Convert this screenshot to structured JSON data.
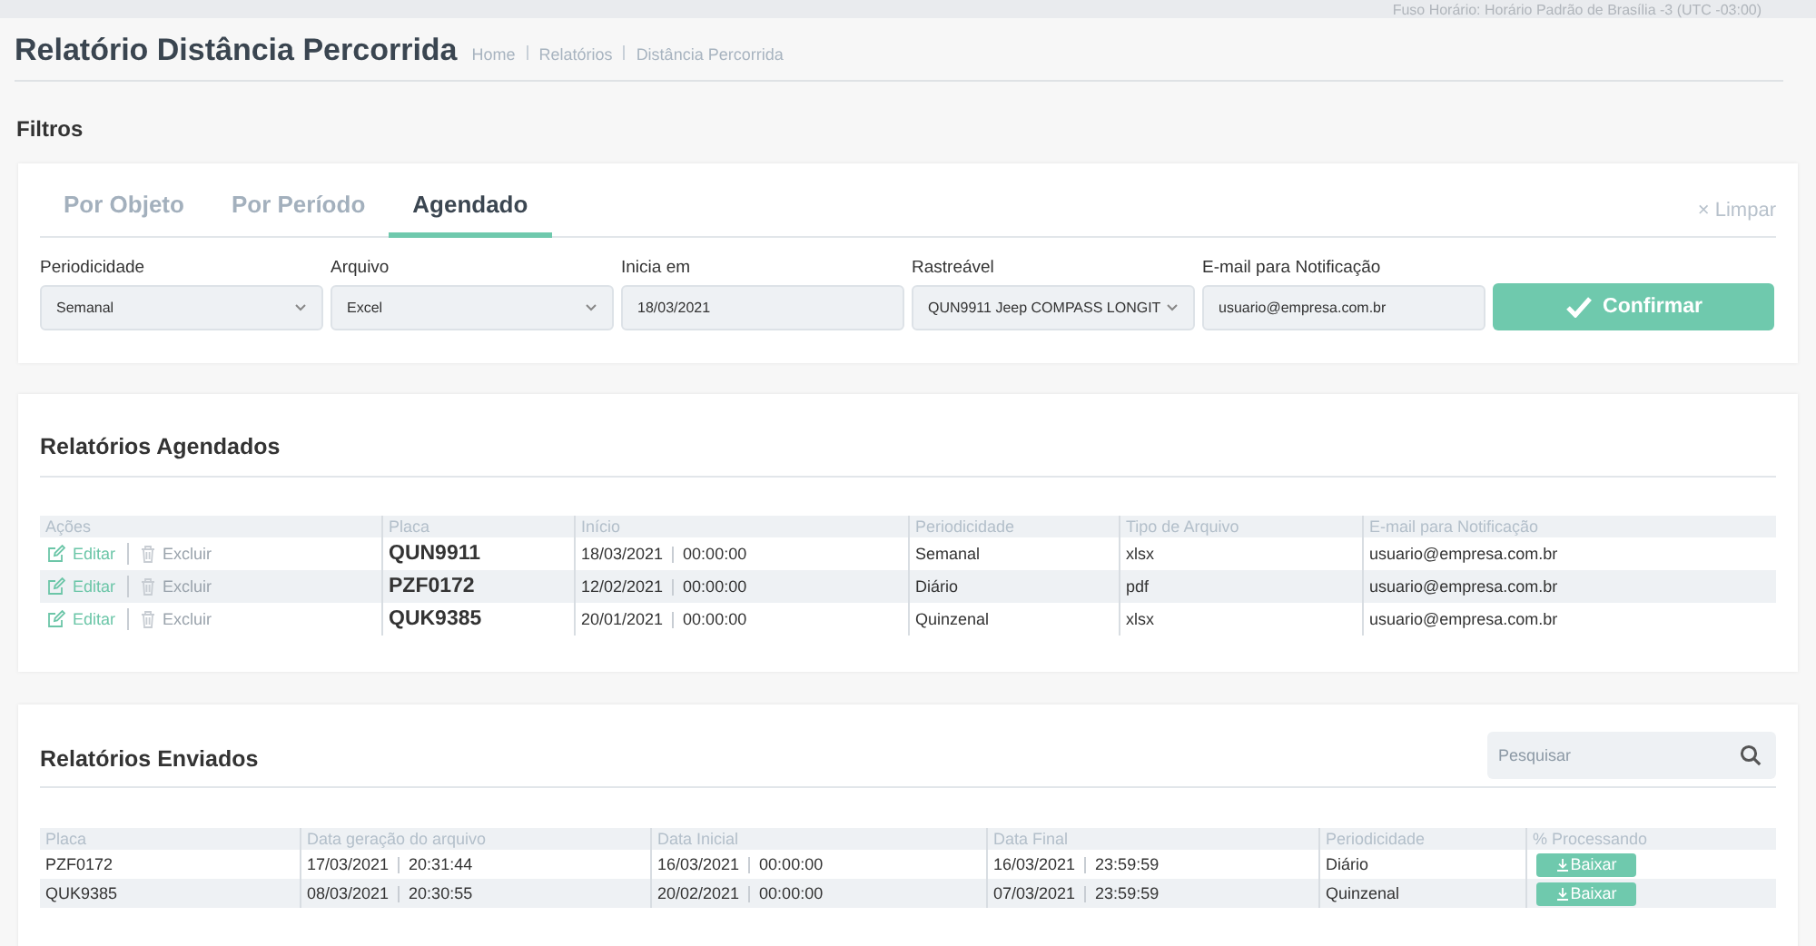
{
  "top_bar": {
    "timezone": "Fuso Horário: Horário Padrão de Brasília -3 (UTC -03:00)"
  },
  "page": {
    "title": "Relatório Distância Percorrida",
    "breadcrumbs": [
      "Home",
      "Relatórios",
      "Distância Percorrida"
    ]
  },
  "filters": {
    "title": "Filtros",
    "tabs": [
      {
        "label": "Por Objeto",
        "selected": false
      },
      {
        "label": "Por Período",
        "selected": false
      },
      {
        "label": "Agendado",
        "selected": true
      }
    ],
    "clear_button": {
      "icon": "×",
      "label": "Limpar"
    },
    "fields": [
      {
        "label": "Periodicidade",
        "kind": "select",
        "value": "Semanal"
      },
      {
        "label": "Arquivo",
        "kind": "select",
        "value": "Excel"
      },
      {
        "label": "Inicia em",
        "kind": "input",
        "value": "18/03/2021"
      },
      {
        "label": "Rastreável",
        "kind": "select",
        "value": "QUN9911 Jeep COMPASS LONGIT"
      },
      {
        "label": "E-mail para Notificação",
        "kind": "input",
        "value": "usuario@empresa.com.br"
      }
    ],
    "confirm_button": "Confirmar"
  },
  "scheduled": {
    "title": "Relatórios Agendados",
    "columns": [
      "Ações",
      "Placa",
      "Início",
      "Periodicidade",
      "Tipo de Arquivo",
      "E-mail para Notificação"
    ],
    "rows": [
      {
        "actions": [
          {
            "kind": "edit",
            "label": "Editar"
          },
          {
            "kind": "delete",
            "label": "Excluir"
          }
        ],
        "plate": "QUN9911",
        "start_date": "18/03/2021",
        "start_time": "00:00:00",
        "periodicity": "Semanal",
        "file_type": "xlsx",
        "email": "usuario@empresa.com.br"
      },
      {
        "actions": [
          {
            "kind": "edit",
            "label": "Editar"
          },
          {
            "kind": "delete",
            "label": "Excluir"
          }
        ],
        "plate": "PZF0172",
        "start_date": "12/02/2021",
        "start_time": "00:00:00",
        "periodicity": "Diário",
        "file_type": "pdf",
        "email": "usuario@empresa.com.br"
      },
      {
        "actions": [
          {
            "kind": "edit",
            "label": "Editar"
          },
          {
            "kind": "delete",
            "label": "Excluir"
          }
        ],
        "plate": "QUK9385",
        "start_date": "20/01/2021",
        "start_time": "00:00:00",
        "periodicity": "Quinzenal",
        "file_type": "xlsx",
        "email": "usuario@empresa.com.br"
      }
    ]
  },
  "sent": {
    "title": "Relatórios Enviados",
    "search": {
      "placeholder": "Pesquisar"
    },
    "columns": [
      "Placa",
      "Data geração do arquivo",
      "Data Inicial",
      "Data Final",
      "Periodicidade",
      "% Processando"
    ],
    "rows": [
      {
        "plate": "PZF0172",
        "generated": [
          "17/03/2021",
          "20:31:44"
        ],
        "start": [
          "16/03/2021",
          "00:00:00"
        ],
        "end": [
          "16/03/2021",
          "23:59:59"
        ],
        "periodicity": "Diário",
        "button": "Baixar"
      },
      {
        "plate": "QUK9385",
        "generated": [
          "08/03/2021",
          "20:30:55"
        ],
        "start": [
          "20/02/2021",
          "00:00:00"
        ],
        "end": [
          "07/03/2021",
          "23:59:59"
        ],
        "periodicity": "Quinzenal",
        "button": "Baixar"
      }
    ]
  }
}
